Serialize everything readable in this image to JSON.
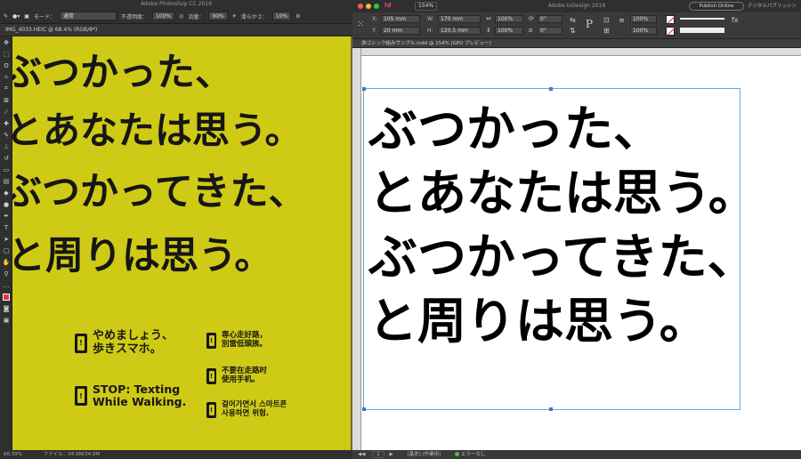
{
  "photoshop": {
    "title": "Adobe Photoshop CC 2019",
    "options": {
      "mode_label": "モード：",
      "mode_value": "通常",
      "opacity_label": "不透明度：",
      "opacity_value": "100%",
      "flow_label": "流量：",
      "flow_value": "90%",
      "smoothing_label": "滑らかさ：",
      "smoothing_value": "10%"
    },
    "doc_tab": "IMG_4033.HEIC @ 68.4% (RGB/8*)",
    "poster_lines": [
      "ぶつかった、",
      "とあなたは思う。",
      "ぶつかってきた、",
      "と周りは思う。"
    ],
    "signs": {
      "ja": "やめましょう、\n歩きスマホ。",
      "zh_tw": "専心走好路，\n別當低頭族。",
      "en": "STOP: Texting\nWhile Walking.",
      "zh_cn": "不要在走路时\n使用手机。",
      "ko": "걸어가면서 스마트폰\n사용하면 위험."
    },
    "status": {
      "zoom": "68.39%",
      "file_info": "ファイル：34.9M/34.9M"
    }
  },
  "indesign": {
    "title": "Adobe InDesign 2019",
    "publish_label": "Publish Online",
    "workspace_label": "デジタルパブリッシング",
    "zoom": "154%",
    "control": {
      "x_label": "X:",
      "x_value": "105 mm",
      "y_label": "Y:",
      "y_value": "20 mm",
      "w_label": "W:",
      "w_value": "170 mm",
      "h_label": "H:",
      "h_value": "120.5 mm",
      "scale_x": "100%",
      "scale_y": "100%",
      "angle": "0°",
      "shear": "0°",
      "stroke_pct": "100%",
      "stroke_pct2": "100%"
    },
    "doc_tab": "游ゴシック組みサンプル.indd @ 154% [GPU プレビュー]",
    "text_lines": [
      "ぶつかった、",
      "とあなたは思う。",
      "ぶつかってきた、",
      "と周りは思う。"
    ],
    "status": {
      "page": "1",
      "style": "[基本] (作業用)",
      "errors": "エラーなし"
    }
  }
}
